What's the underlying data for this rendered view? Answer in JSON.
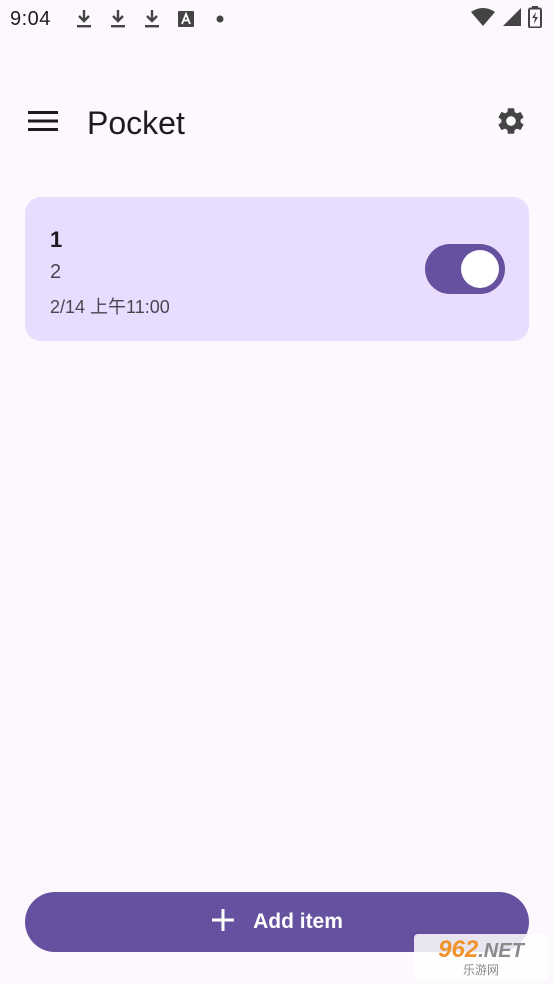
{
  "status_bar": {
    "time": "9:04",
    "icons": [
      "download-icon",
      "download-icon",
      "download-icon",
      "a-icon",
      "dot-icon"
    ],
    "right_icons": [
      "wifi-icon",
      "signal-icon",
      "battery-icon"
    ]
  },
  "app_bar": {
    "title": "Pocket",
    "menu_icon": "menu-icon",
    "settings_icon": "gear-icon"
  },
  "items": [
    {
      "title": "1",
      "subtitle": "2",
      "time": "2/14 上午11:00",
      "enabled": true
    }
  ],
  "add_button": {
    "label": "Add item",
    "icon": "plus-icon"
  },
  "watermark": {
    "main_number": "962",
    "main_suffix": ".NET",
    "sub": "乐游网"
  },
  "colors": {
    "background": "#fdf7fe",
    "card": "#e9ddff",
    "accent": "#65519f"
  }
}
